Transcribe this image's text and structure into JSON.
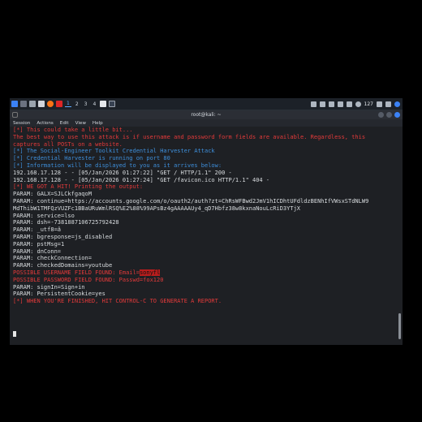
{
  "taskbar": {
    "workspaces": [
      "1",
      "2",
      "3",
      "4"
    ],
    "clock": "127"
  },
  "window": {
    "title": "root@kali: ~"
  },
  "menu": {
    "items": [
      "Session",
      "Actions",
      "Edit",
      "View",
      "Help"
    ]
  },
  "terminal": {
    "line_01": "[*] This could take a little bit...",
    "line_02": "",
    "line_03": "The best way to use this attack is if username and password form fields are available. Regardless, this",
    "line_04": "captures all POSTs on a website.",
    "line_05": "[*] The Social-Engineer Toolkit Credential Harvester Attack",
    "line_06": "[*] Credential Harvester is running on port 80",
    "line_07": "[*] Information will be displayed to you as it arrives below:",
    "line_08": "192.168.17.128 - - [05/Jan/2026 01:27:22] \"GET / HTTP/1.1\" 200 -",
    "line_09": "192.168.17.128 - - [05/Jan/2026 01:27:24] \"GET /favicon.ico HTTP/1.1\" 404 -",
    "line_10": "[*] WE GOT A HIT! Printing the output:",
    "line_11": "PARAM: GALX=SJLCkfgaqoM",
    "line_12": "PARAM: continue=https://accounts.google.com/o/oauth2/auth?zt=ChRsWFBwd2JmV1hICDhtUFdldzBENhIfVWsxSTdNLW9",
    "line_13": "MdThibW1TMFQzVUZFc1BBaURuWmlRSQ%E2%88%99APsBz4gAAAAAUy4_qD7Hbfz38w8kxnaNouLcRiD3YTjX",
    "line_14": "PARAM: service=lso",
    "line_15": "PARAM: dsh=-7381887106725792428",
    "line_16": "PARAM: _utf8=â",
    "line_17": "PARAM: bgresponse=js_disabled",
    "line_18": "PARAM: pstMsg=1",
    "line_19": "PARAM: dnConn=",
    "line_20": "PARAM: checkConnection=",
    "line_21": "PARAM: checkedDomains=youtube",
    "line_22_prefix": "POSSIBLE USERNAME FIELD FOUND: Email=",
    "line_22_value": "sonyfl",
    "line_23": "POSSIBLE PASSWORD FIELD FOUND: Passwd=fox120",
    "line_24": "PARAM: signIn=Sign+in",
    "line_25": "PARAM: PersistentCookie=yes",
    "line_26": "[*] WHEN YOU'RE FINISHED, HIT CONTROL-C TO GENERATE A REPORT."
  },
  "colors": {
    "red": "#e33a3a",
    "blue": "#3e8fdb",
    "green": "#5ec46a",
    "text": "#d8dcdf",
    "accent": "#3b82f6"
  }
}
